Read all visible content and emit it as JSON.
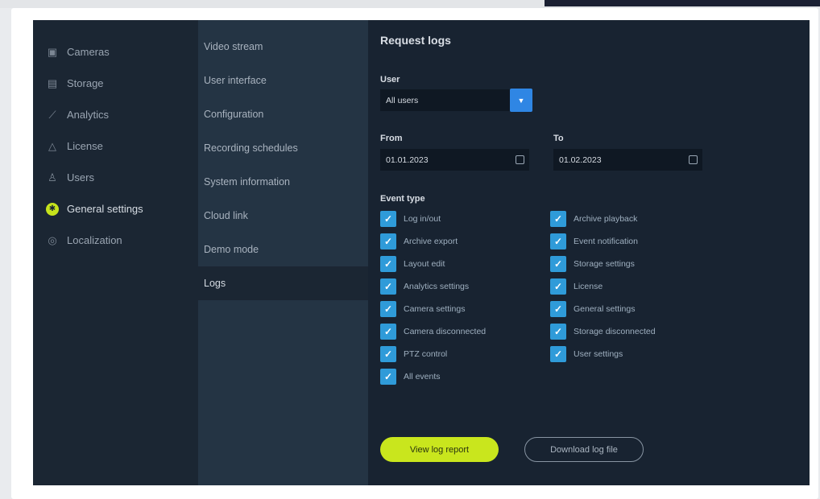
{
  "nav": {
    "items": [
      {
        "label": "Cameras",
        "icon": "camera-icon"
      },
      {
        "label": "Storage",
        "icon": "storage-icon"
      },
      {
        "label": "Analytics",
        "icon": "analytics-icon"
      },
      {
        "label": "License",
        "icon": "license-icon"
      },
      {
        "label": "Users",
        "icon": "users-icon"
      },
      {
        "label": "General settings",
        "icon": "gear-icon"
      },
      {
        "label": "Localization",
        "icon": "globe-icon"
      }
    ],
    "active_index": 5,
    "accent": "#c6e31c"
  },
  "subnav": {
    "items": [
      {
        "label": "Video stream"
      },
      {
        "label": "User interface"
      },
      {
        "label": "Configuration"
      },
      {
        "label": "Recording schedules"
      },
      {
        "label": "System information"
      },
      {
        "label": "Cloud link"
      },
      {
        "label": "Demo mode"
      },
      {
        "label": "Logs"
      }
    ],
    "active_index": 7
  },
  "main": {
    "title": "Request logs",
    "user_label": "User",
    "user_value": "All users",
    "from_label": "From",
    "from_value": "01.01.2023",
    "to_label": "To",
    "to_value": "01.02.2023",
    "event_type_label": "Event type",
    "events_left": [
      {
        "label": "Log in/out",
        "checked": true
      },
      {
        "label": "Archive export",
        "checked": true
      },
      {
        "label": "Layout edit",
        "checked": true
      },
      {
        "label": "Analytics settings",
        "checked": true
      },
      {
        "label": "Camera settings",
        "checked": true
      },
      {
        "label": "Camera disconnected",
        "checked": true
      },
      {
        "label": "PTZ control",
        "checked": true
      },
      {
        "label": "All events",
        "checked": true
      }
    ],
    "events_right": [
      {
        "label": "Archive playback",
        "checked": true
      },
      {
        "label": "Event notification",
        "checked": true
      },
      {
        "label": "Storage settings",
        "checked": true
      },
      {
        "label": "License",
        "checked": true
      },
      {
        "label": "General settings",
        "checked": true
      },
      {
        "label": "Storage disconnected",
        "checked": true
      },
      {
        "label": "User settings",
        "checked": true
      }
    ],
    "view_button": "View log report",
    "download_button": "Download log file"
  },
  "colors": {
    "checkbox": "#2f9bd9",
    "primary_button": "#c9e61d",
    "dropdown_button": "#2f86e4"
  }
}
